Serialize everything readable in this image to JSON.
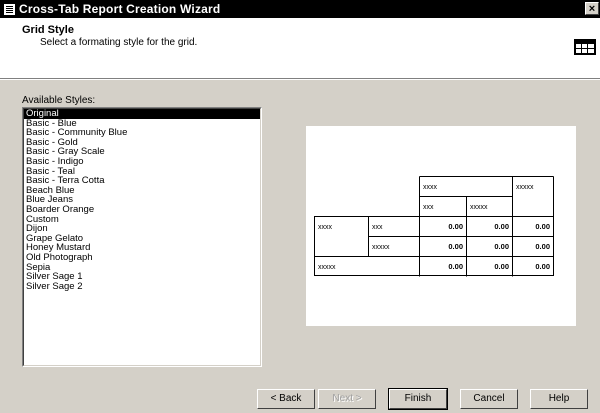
{
  "window": {
    "title": "Cross-Tab Report Creation Wizard",
    "close_label": "×"
  },
  "header": {
    "title": "Grid Style",
    "subtitle": "Select a formating style for the grid."
  },
  "styles": {
    "label": "Available Styles:",
    "items": [
      "Original",
      "Basic - Blue",
      "Basic - Community Blue",
      "Basic - Gold",
      "Basic - Gray Scale",
      "Basic - Indigo",
      "Basic - Teal",
      "Basic - Terra Cotta",
      "Beach Blue",
      "Blue Jeans",
      "Boarder Orange",
      "Custom",
      "Dijon",
      "Grape Gelato",
      "Honey Mustard",
      "Old Photograph",
      "Sepia",
      "Silver Sage 1",
      "Silver Sage 2"
    ],
    "selected": "Original"
  },
  "preview": {
    "col_header": [
      "xxxx",
      "xxxxx"
    ],
    "col_sub": [
      "xxx",
      "xxxxx"
    ],
    "row_outer": [
      "xxxx",
      "xxxxx"
    ],
    "row_inner": [
      "xxx",
      "xxxxx"
    ],
    "value": "0.00"
  },
  "buttons": {
    "back": "< Back",
    "next": "Next >",
    "finish": "Finish",
    "cancel": "Cancel",
    "help": "Help"
  }
}
